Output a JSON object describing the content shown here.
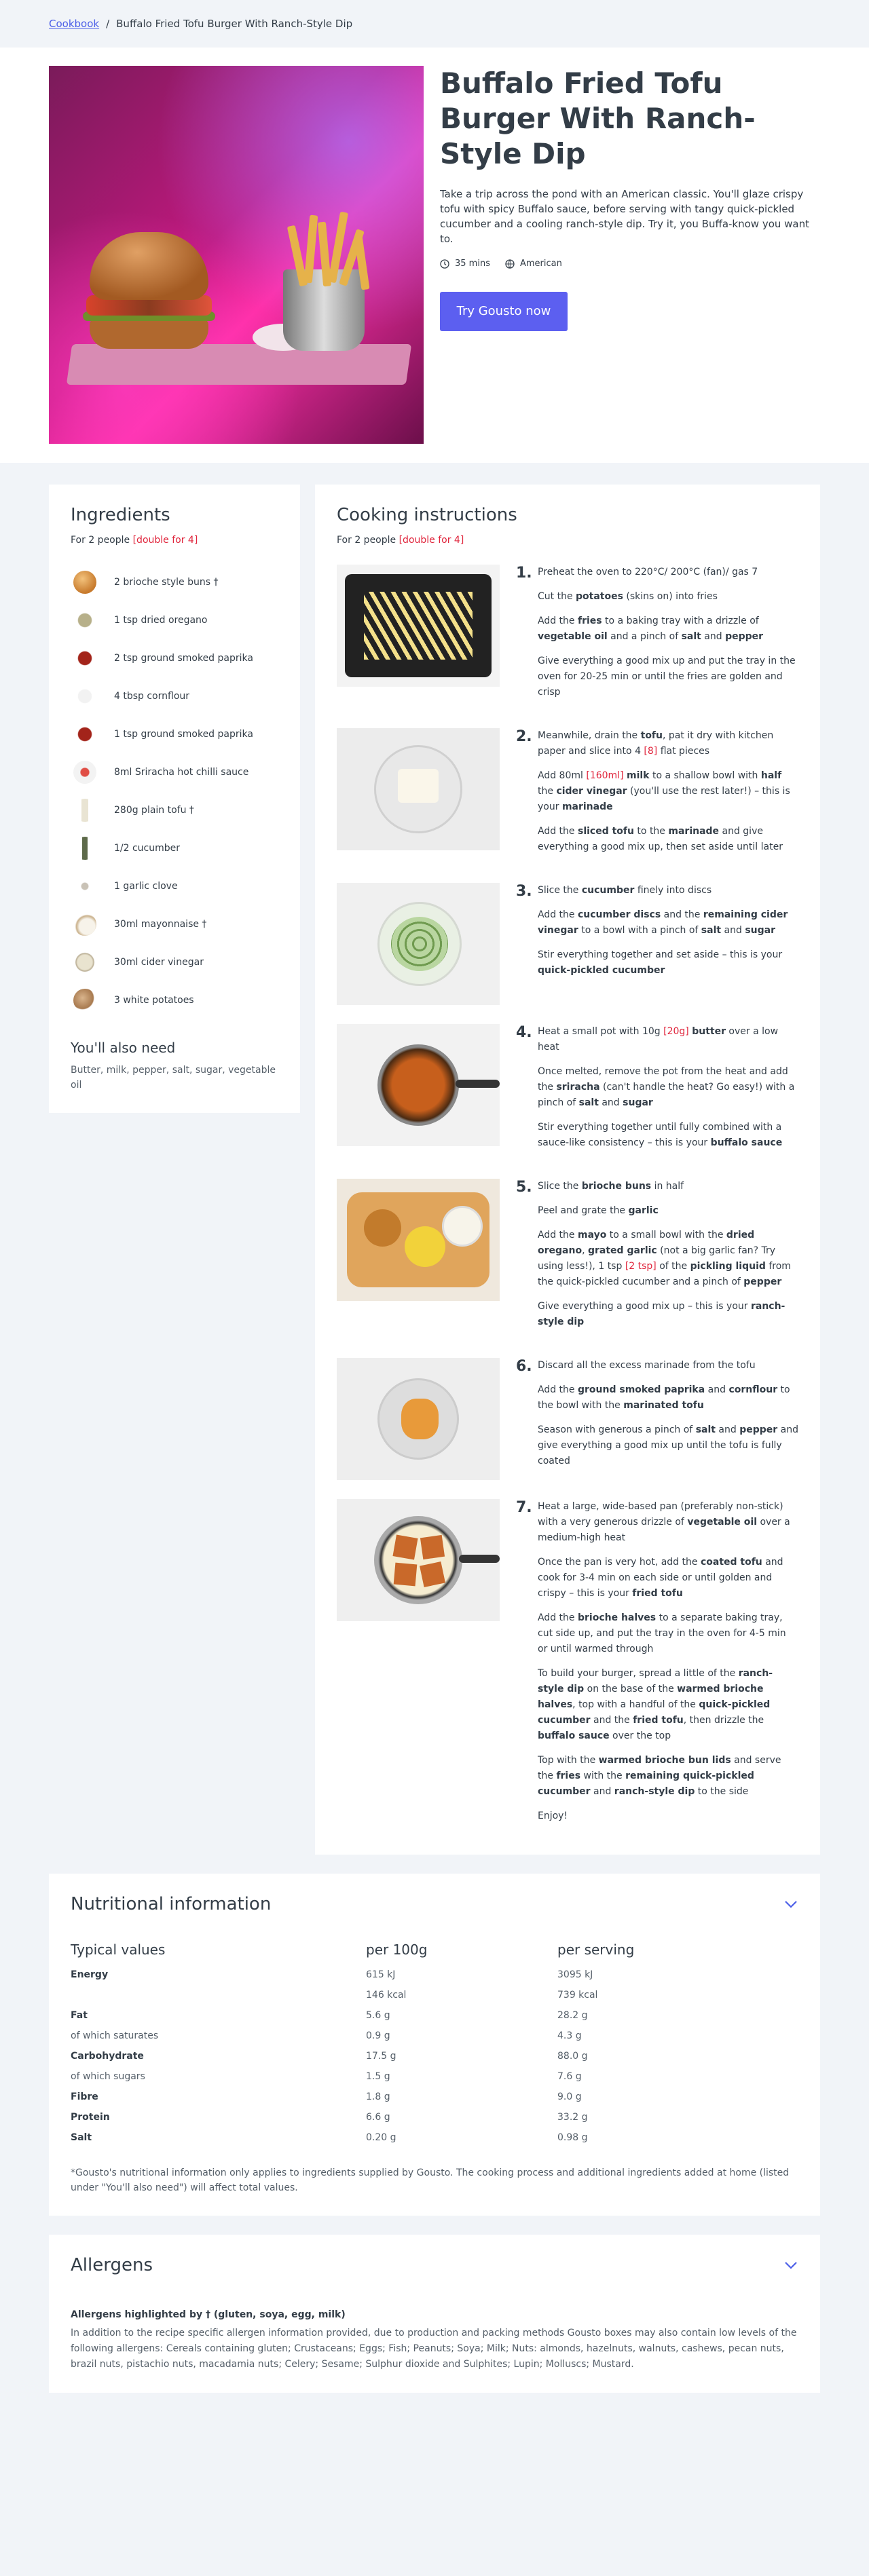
{
  "breadcrumb": {
    "root": "Cookbook",
    "separator": "/",
    "current": "Buffalo Fried Tofu Burger With Ranch-Style Dip"
  },
  "hero": {
    "title": "Buffalo Fried Tofu Burger With Ranch-Style Dip",
    "description": "Take a trip across the pond with an American classic. You'll glaze crispy tofu with spicy Buffalo sauce, before serving with tangy quick-pickled cucumber and a cooling ranch-style dip. Try it, you Buffa-know you want to.",
    "time": "35 mins",
    "cuisine": "American",
    "cta": "Try Gousto now"
  },
  "ingredients": {
    "title": "Ingredients",
    "for_people": "For 2 people",
    "double": "[double for 4]",
    "items": [
      "2 brioche style buns †",
      "1 tsp dried oregano",
      "2 tsp ground smoked paprika",
      "4 tbsp cornflour",
      "1 tsp ground smoked paprika",
      "8ml Sriracha hot chilli sauce",
      "280g plain tofu †",
      "1/2 cucumber",
      "1 garlic clove",
      "30ml mayonnaise †",
      "30ml cider vinegar",
      "3 white potatoes"
    ],
    "also_title": "You'll also need",
    "also_text": "Butter, milk, pepper, salt, sugar, vegetable oil"
  },
  "cooking": {
    "title": "Cooking instructions",
    "for_people": "For 2 people",
    "double": "[double for 4]"
  },
  "nutrition": {
    "title": "Nutritional information",
    "headers": [
      "Typical values",
      "per 100g",
      "per serving"
    ],
    "rows": [
      {
        "label": "Energy",
        "p100": "615 kJ",
        "pserv": "3095 kJ",
        "strong": true
      },
      {
        "label": "",
        "p100": "146 kcal",
        "pserv": "739 kcal",
        "strong": false
      },
      {
        "label": "Fat",
        "p100": "5.6 g",
        "pserv": "28.2 g",
        "strong": true
      },
      {
        "label": "of which saturates",
        "p100": "0.9 g",
        "pserv": "4.3 g",
        "strong": false
      },
      {
        "label": "Carbohydrate",
        "p100": "17.5 g",
        "pserv": "88.0 g",
        "strong": true
      },
      {
        "label": "of which sugars",
        "p100": "1.5 g",
        "pserv": "7.6 g",
        "strong": false
      },
      {
        "label": "Fibre",
        "p100": "1.8 g",
        "pserv": "9.0 g",
        "strong": true
      },
      {
        "label": "Protein",
        "p100": "6.6 g",
        "pserv": "33.2 g",
        "strong": true
      },
      {
        "label": "Salt",
        "p100": "0.20 g",
        "pserv": "0.98 g",
        "strong": true
      }
    ],
    "note": "*Gousto's nutritional information only applies to ingredients supplied by Gousto. The cooking process and additional ingredients added at home (listed under \"You'll also need\") will affect total values."
  },
  "allergens": {
    "title": "Allergens",
    "highlight": "Allergens highlighted by † (gluten, soya, egg, milk)",
    "text": "In addition to the recipe specific allergen information provided, due to production and packing methods Gousto boxes may also contain low levels of the following allergens: Cereals containing gluten; Crustaceans; Eggs; Fish; Peanuts; Soya; Milk; Nuts: almonds, hazelnuts, walnuts, cashews, pecan nuts, brazil nuts, pistachio nuts, macadamia nuts; Celery; Sesame; Sulphur dioxide and Sulphites; Lupin; Molluscs; Mustard."
  },
  "colors": {
    "accent": "#5c5ff0",
    "link": "#4b5ee8",
    "highlight_red": "#e0243b",
    "text": "#333d47",
    "page_bg": "#f1f4f8"
  },
  "icons": [
    "clock-icon",
    "globe-icon",
    "chevron-down-icon"
  ],
  "steps": [
    {
      "number": "1.",
      "paragraphs": [
        "Preheat the oven to 220°C/ 200°C (fan)/ gas 7",
        "Cut the <b>potatoes</b> (skins on) into fries",
        "Add the <b>fries</b> to a baking tray with a drizzle of <b>vegetable oil</b> and a pinch of <b>salt</b> and <b>pepper</b>",
        "Give everything a good mix up and put the tray in the oven for 20-25 min or until the fries are golden and crisp"
      ]
    },
    {
      "number": "2.",
      "paragraphs": [
        "Meanwhile, drain the <b>tofu</b>, pat it dry with kitchen paper and slice into 4 <span class=\"red\">[8]</span> flat pieces",
        "Add 80ml <span class=\"red\">[160ml]</span> <b>milk</b> to a shallow bowl with <b>half</b> the <b>cider vinegar</b> (you'll use the rest later!) – this is your <b>marinade</b>",
        "Add the <b>sliced tofu</b> to the <b>marinade</b> and give everything a good mix up, then set aside until later"
      ]
    },
    {
      "number": "3.",
      "paragraphs": [
        "Slice the <b>cucumber</b> finely into discs",
        "Add the <b>cucumber discs</b> and the <b>remaining cider vinegar</b> to a bowl with a pinch of <b>salt</b> and <b>sugar</b>",
        "Stir everything together and set aside – this is your <b>quick-pickled cucumber</b>"
      ]
    },
    {
      "number": "4.",
      "paragraphs": [
        "Heat a small pot with 10g <span class=\"red\">[20g]</span> <b>butter</b> over a low heat",
        "Once melted, remove the pot from the heat and add the <b>sriracha</b> (can't handle the heat? Go easy!) with a pinch of <b>salt</b> and <b>sugar</b>",
        "Stir everything together until fully combined with a sauce-like consistency – this is your <b>buffalo sauce</b>"
      ]
    },
    {
      "number": "5.",
      "paragraphs": [
        "Slice the <b>brioche buns</b> in half",
        "Peel and grate the <b>garlic</b>",
        "Add the <b>mayo</b> to a small bowl with the <b>dried oregano</b>, <b>grated garlic</b> (not a big garlic fan? Try using less!), 1 tsp <span class=\"red\">[2 tsp]</span> of the <b>pickling liquid</b> from the quick-pickled cucumber and a pinch of <b>pepper</b>",
        "Give everything a good mix up – this is your <b>ranch-style dip</b>"
      ]
    },
    {
      "number": "6.",
      "paragraphs": [
        "Discard all the excess marinade from the tofu",
        "Add the <b>ground smoked paprika</b> and <b>cornflour</b> to the bowl with the <b>marinated tofu</b>",
        "Season with generous a pinch of <b>salt</b> and <b>pepper</b> and give everything a good mix up until the tofu is fully coated"
      ]
    },
    {
      "number": "7.",
      "paragraphs": [
        "Heat a large, wide-based pan (preferably non-stick) with a very generous drizzle of <b>vegetable oil</b> over a medium-high heat",
        "Once the pan is very hot, add the <b>coated tofu</b> and cook for 3-4 min on each side or until golden and crispy – this is your <b>fried tofu</b>",
        "Add the <b>brioche halves</b> to a separate baking tray, cut side up, and put the tray in the oven for 4-5 min or until warmed through",
        "To build your burger, spread a little of the <b>ranch-style dip</b> on the base of the <b>warmed brioche halves</b>, top with a handful of the <b>quick-pickled cucumber</b> and the <b>fried tofu</b>, then drizzle the <b>buffalo sauce</b> over the top",
        "Top with the <b>warmed brioche bun lids</b> and serve the <b>fries</b> with the <b>remaining quick-pickled cucumber</b> and <b>ranch-style dip</b> to the side",
        "Enjoy!"
      ]
    }
  ]
}
